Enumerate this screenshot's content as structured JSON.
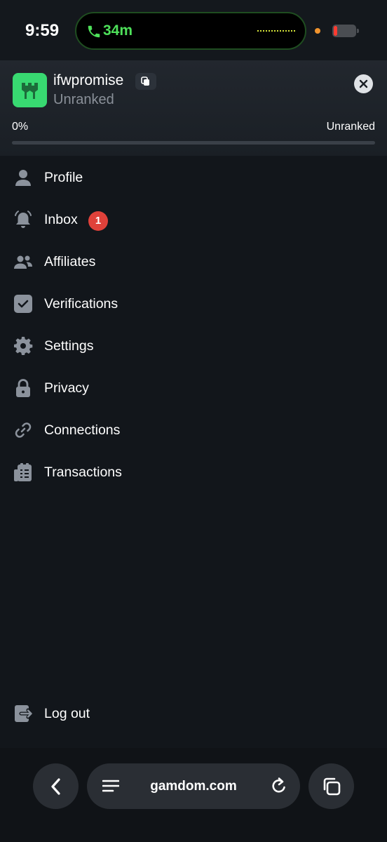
{
  "status_bar": {
    "time": "9:59",
    "call_duration": "34m"
  },
  "header": {
    "username": "ifwpromise",
    "rank_subtitle": "Unranked",
    "progress_label": "0%",
    "progress_value": 0,
    "rank_label_right": "Unranked"
  },
  "menu": {
    "items": [
      {
        "label": "Profile",
        "icon": "user-icon"
      },
      {
        "label": "Inbox",
        "icon": "bell-icon",
        "badge": "1"
      },
      {
        "label": "Affiliates",
        "icon": "users-icon"
      },
      {
        "label": "Verifications",
        "icon": "checkbox-icon"
      },
      {
        "label": "Settings",
        "icon": "gear-icon"
      },
      {
        "label": "Privacy",
        "icon": "lock-icon"
      },
      {
        "label": "Connections",
        "icon": "link-icon"
      },
      {
        "label": "Transactions",
        "icon": "receipt-icon"
      }
    ],
    "logout": {
      "label": "Log out",
      "icon": "logout-icon"
    }
  },
  "browser": {
    "url": "gamdom.com"
  },
  "colors": {
    "background": "#12161b",
    "accent_green": "#38d971",
    "badge_red": "#e0413a",
    "icon_gray": "#8b929c"
  }
}
